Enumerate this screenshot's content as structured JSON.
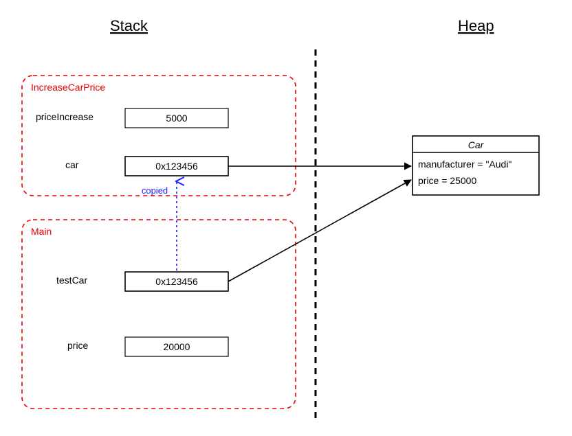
{
  "titles": {
    "stack": "Stack",
    "heap": "Heap"
  },
  "frames": {
    "increase": {
      "label": "IncreaseCarPrice",
      "vars": {
        "priceIncrease": {
          "label": "priceIncrease",
          "value": "5000"
        },
        "car": {
          "label": "car",
          "value": "0x123456"
        }
      }
    },
    "main": {
      "label": "Main",
      "vars": {
        "testCar": {
          "label": "testCar",
          "value": "0x123456"
        },
        "price": {
          "label": "price",
          "value": "20000"
        }
      }
    }
  },
  "copied_label": "copied",
  "heap_object": {
    "class": "Car",
    "fields": {
      "manufacturer": "manufacturer = \"Audi\"",
      "price": "price = 25000"
    }
  }
}
